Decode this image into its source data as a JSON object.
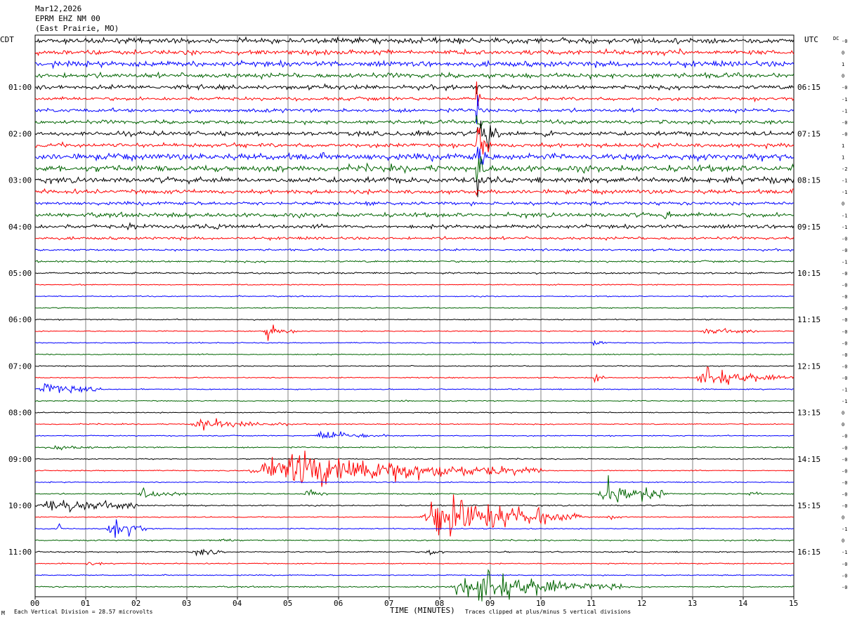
{
  "header": {
    "date": "Mar12,2026",
    "station": "EPRM EHZ NM 00",
    "location": "(East Prairie, MO)"
  },
  "left_timezone": "CDT",
  "right_timezone": "UTC",
  "dc_label": "DC",
  "footer": {
    "scale_note": "Each Vertical Division =   28.57 microvolts",
    "x_title": "TIME (MINUTES)",
    "clip_note": "Traces clipped at plus/minus 5 vertical divisions",
    "corner_mark": "M"
  },
  "chart_data": {
    "type": "line",
    "x_ticks": [
      "00",
      "01",
      "02",
      "03",
      "04",
      "05",
      "06",
      "07",
      "08",
      "09",
      "10",
      "11",
      "12",
      "13",
      "14",
      "15"
    ],
    "xlim": [
      0,
      15
    ],
    "xlabel": "TIME (MINUTES)",
    "grid": true,
    "trace_colors": [
      "#000000",
      "#ff0000",
      "#0000ff",
      "#006400"
    ],
    "left_labels": [
      "",
      "",
      "",
      "",
      "01:00",
      "",
      "",
      "",
      "02:00",
      "",
      "",
      "",
      "03:00",
      "",
      "",
      "",
      "04:00",
      "",
      "",
      "",
      "05:00",
      "",
      "",
      "",
      "06:00",
      "",
      "",
      "",
      "07:00",
      "",
      "",
      "",
      "08:00",
      "",
      "",
      "",
      "09:00",
      "",
      "",
      "",
      "10:00",
      "",
      "",
      "",
      "11:00",
      "",
      "",
      ""
    ],
    "right_labels": [
      "",
      "",
      "",
      "",
      "06:15",
      "",
      "",
      "",
      "07:15",
      "",
      "",
      "",
      "08:15",
      "",
      "",
      "",
      "09:15",
      "",
      "",
      "",
      "10:15",
      "",
      "",
      "",
      "11:15",
      "",
      "",
      "",
      "12:15",
      "",
      "",
      "",
      "13:15",
      "",
      "",
      "",
      "14:15",
      "",
      "",
      "",
      "15:15",
      "",
      "",
      "",
      "16:15",
      "",
      "",
      ""
    ],
    "dc_values": [
      "-0",
      "0",
      "1",
      "0",
      "-0",
      "-1",
      "-1",
      "-0",
      "-0",
      "1",
      "1",
      "-2",
      "-1",
      "-1",
      "0",
      "-1",
      "-1",
      "-0",
      "-0",
      "-1",
      "-0",
      "-0",
      "-0",
      "-0",
      "-0",
      "-0",
      "-0",
      "-0",
      "-0",
      "-0",
      "-1",
      "-1",
      "0",
      "0",
      "-0",
      "-0",
      "-0",
      "-0",
      "-0",
      "-0",
      "-0",
      "0",
      "-1",
      "0",
      "-1",
      "-0",
      "-0",
      "-0"
    ],
    "noise": [
      2.5,
      2.3,
      2.6,
      2.3,
      2.0,
      1.6,
      1.7,
      1.8,
      2.0,
      2.0,
      3.0,
      3.0,
      2.6,
      2.0,
      1.6,
      2.0,
      1.8,
      1.3,
      0.9,
      0.9,
      0.8,
      0.5,
      0.5,
      0.5,
      0.5,
      0.5,
      0.5,
      0.5,
      0.5,
      0.5,
      0.5,
      0.5,
      0.5,
      0.5,
      0.5,
      0.6,
      0.5,
      0.5,
      0.5,
      0.6,
      0.6,
      0.5,
      0.5,
      0.6,
      0.6,
      0.5,
      0.5,
      0.6
    ],
    "events": [
      {
        "trace": 4,
        "start": 8.72,
        "duration": 0.08,
        "amplitude": 30
      },
      {
        "trace": 5,
        "start": 8.72,
        "duration": 0.1,
        "amplitude": 30
      },
      {
        "trace": 6,
        "start": 8.72,
        "duration": 0.1,
        "amplitude": 30
      },
      {
        "trace": 7,
        "start": 8.72,
        "duration": 0.12,
        "amplitude": 30
      },
      {
        "trace": 8,
        "start": 8.72,
        "duration": 0.5,
        "amplitude": 20
      },
      {
        "trace": 9,
        "start": 8.72,
        "duration": 0.3,
        "amplitude": 30
      },
      {
        "trace": 10,
        "start": 8.72,
        "duration": 0.2,
        "amplitude": 30
      },
      {
        "trace": 11,
        "start": 8.72,
        "duration": 0.2,
        "amplitude": 30
      },
      {
        "trace": 12,
        "start": 8.72,
        "duration": 0.2,
        "amplitude": 15
      },
      {
        "trace": 8,
        "start": 7.4,
        "duration": 0.4,
        "amplitude": 4
      },
      {
        "trace": 8,
        "start": 10.0,
        "duration": 0.4,
        "amplitude": 4
      },
      {
        "trace": 16,
        "start": 1.8,
        "duration": 0.4,
        "amplitude": 4
      },
      {
        "trace": 16,
        "start": 3.5,
        "duration": 0.3,
        "amplitude": 3
      },
      {
        "trace": 15,
        "start": 12.4,
        "duration": 0.4,
        "amplitude": 4
      },
      {
        "trace": 22,
        "start": 4.0,
        "duration": 0.05,
        "amplitude": 4
      },
      {
        "trace": 25,
        "start": 4.5,
        "duration": 0.7,
        "amplitude": 8
      },
      {
        "trace": 25,
        "start": 13.1,
        "duration": 1.2,
        "amplitude": 3
      },
      {
        "trace": 26,
        "start": 11.0,
        "duration": 0.3,
        "amplitude": 5
      },
      {
        "trace": 29,
        "start": 11.0,
        "duration": 0.3,
        "amplitude": 6
      },
      {
        "trace": 29,
        "start": 13.0,
        "duration": 2.0,
        "amplitude": 10
      },
      {
        "trace": 30,
        "start": 0.0,
        "duration": 1.3,
        "amplitude": 9
      },
      {
        "trace": 31,
        "start": 7.2,
        "duration": 0.2,
        "amplitude": 3
      },
      {
        "trace": 33,
        "start": 3.0,
        "duration": 2.0,
        "amplitude": 5
      },
      {
        "trace": 34,
        "start": 5.5,
        "duration": 1.6,
        "amplitude": 5
      },
      {
        "trace": 35,
        "start": 0.3,
        "duration": 1.0,
        "amplitude": 3
      },
      {
        "trace": 37,
        "start": 4.2,
        "duration": 5.8,
        "amplitude": 22
      },
      {
        "trace": 39,
        "start": 2.0,
        "duration": 1.0,
        "amplitude": 5
      },
      {
        "trace": 39,
        "start": 5.3,
        "duration": 0.5,
        "amplitude": 6
      },
      {
        "trace": 39,
        "start": 11.1,
        "duration": 1.4,
        "amplitude": 20
      },
      {
        "trace": 39,
        "start": 14.1,
        "duration": 0.3,
        "amplitude": 3
      },
      {
        "trace": 40,
        "start": 0.0,
        "duration": 2.0,
        "amplitude": 10
      },
      {
        "trace": 41,
        "start": 7.6,
        "duration": 3.2,
        "amplitude": 25
      },
      {
        "trace": 41,
        "start": 11.3,
        "duration": 0.4,
        "amplitude": 4
      },
      {
        "trace": 42,
        "start": 0.45,
        "duration": 0.1,
        "amplitude": 12
      },
      {
        "trace": 42,
        "start": 1.4,
        "duration": 0.8,
        "amplitude": 14
      },
      {
        "trace": 43,
        "start": 3.6,
        "duration": 0.4,
        "amplitude": 3
      },
      {
        "trace": 44,
        "start": 3.1,
        "duration": 0.6,
        "amplitude": 5
      },
      {
        "trace": 44,
        "start": 7.7,
        "duration": 0.4,
        "amplitude": 4
      },
      {
        "trace": 45,
        "start": 1.0,
        "duration": 0.4,
        "amplitude": 3
      },
      {
        "trace": 47,
        "start": 8.2,
        "duration": 3.4,
        "amplitude": 18
      }
    ]
  }
}
